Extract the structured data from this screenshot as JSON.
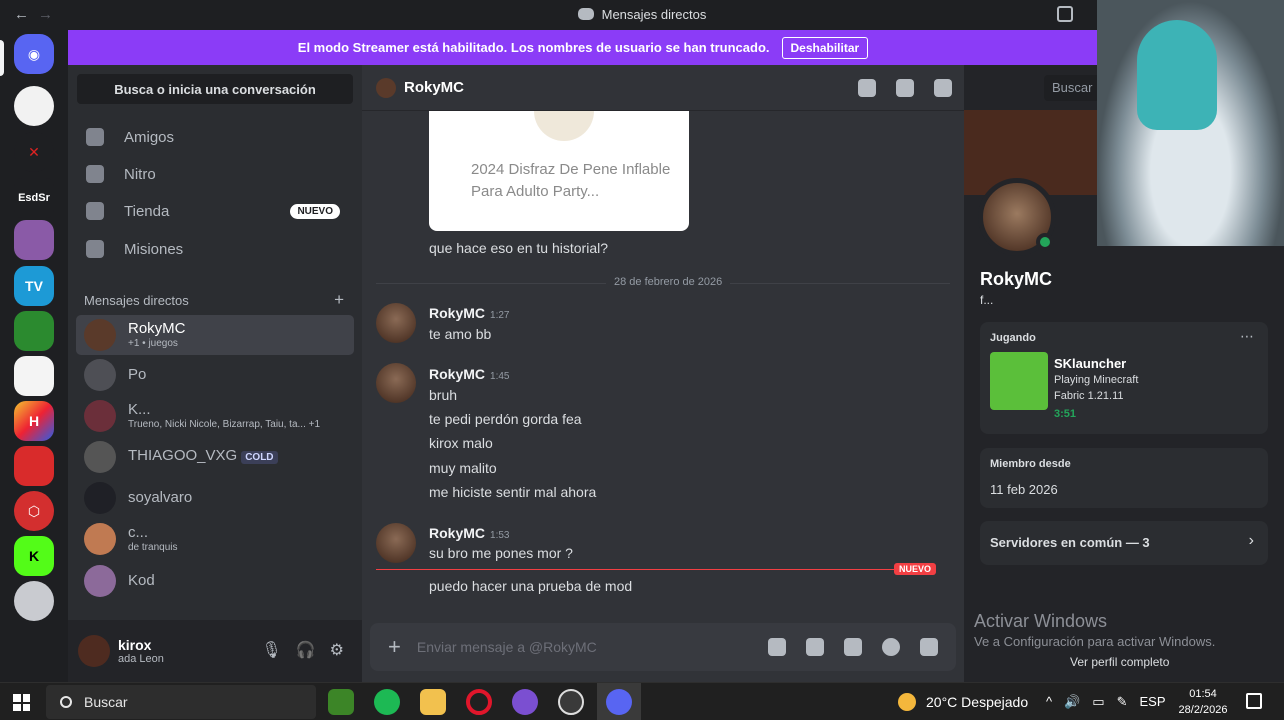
{
  "window": {
    "title": "Mensajes directos",
    "back": "←",
    "forward": "→"
  },
  "streamer": {
    "text": "El modo Streamer está habilitado. Los nombres de usuario se han truncado.",
    "button": "Deshabilitar"
  },
  "servers": {
    "label_esd": "EsdSr"
  },
  "dm_sidebar": {
    "search": "Busca o inicia una conversación",
    "nav": [
      {
        "label": "Amigos"
      },
      {
        "label": "Nitro"
      },
      {
        "label": "Tienda",
        "badge": "NUEVO"
      },
      {
        "label": "Misiones"
      }
    ],
    "header": "Mensajes directos",
    "add": "+",
    "dms": [
      {
        "name": "RokyMC",
        "sub": "+1 • juegos"
      },
      {
        "name": "Po",
        "sub": ""
      },
      {
        "name": "K...",
        "sub": "Trueno, Nicki Nicole, Bizarrap, Taiu, ta... +1"
      },
      {
        "name": "THIAGOO_VXG",
        "tag": "COLD"
      },
      {
        "name": "soyalvaro",
        "sub": ""
      },
      {
        "name": "c...",
        "sub": "de tranquis"
      },
      {
        "name": "Kod",
        "sub": ""
      }
    ],
    "user": {
      "name": "kirox",
      "status": "ada",
      "game": "Leon"
    }
  },
  "chat": {
    "recipient": "RokyMC",
    "embed_text": "2024 Disfraz De Pene Inflable Para Adulto Party...",
    "pre_message": "que hace eso en tu historial?",
    "date": "28 de febrero de 2026",
    "groups": [
      {
        "author": "RokyMC",
        "time": "1:27",
        "lines": [
          "te amo bb"
        ]
      },
      {
        "author": "RokyMC",
        "time": "1:45",
        "lines": [
          "bruh",
          "te pedi perdón gorda fea",
          "kirox malo",
          "muy malito",
          "me hiciste sentir mal ahora"
        ]
      },
      {
        "author": "RokyMC",
        "time": "1:53",
        "lines": [
          "su bro me pones mor ?"
        ]
      }
    ],
    "new_label": "NUEVO",
    "after_new": "puedo hacer una prueba de mod",
    "composer_placeholder": "Enviar mensaje a @RokyMC",
    "search_placeholder": "Buscar r"
  },
  "profile": {
    "name": "RokyMC",
    "sub": "f...",
    "playing_header": "Jugando",
    "game_title": "SKlauncher",
    "game_line1": "Playing Minecraft",
    "game_line2": "Fabric 1.21.11",
    "game_time": "3:51",
    "member_header": "Miembro desde",
    "member_date": "11 feb 2026",
    "servers_common": "Servidores en común — 3",
    "view_profile": "Ver perfil completo"
  },
  "watermark": {
    "line1": "Activar Windows",
    "line2": "Ve a Configuración para activar Windows."
  },
  "taskbar": {
    "search": "Buscar",
    "weather": "20°C  Despejado",
    "lang": "ESP",
    "time": "01:54",
    "date": "28/2/2026"
  }
}
